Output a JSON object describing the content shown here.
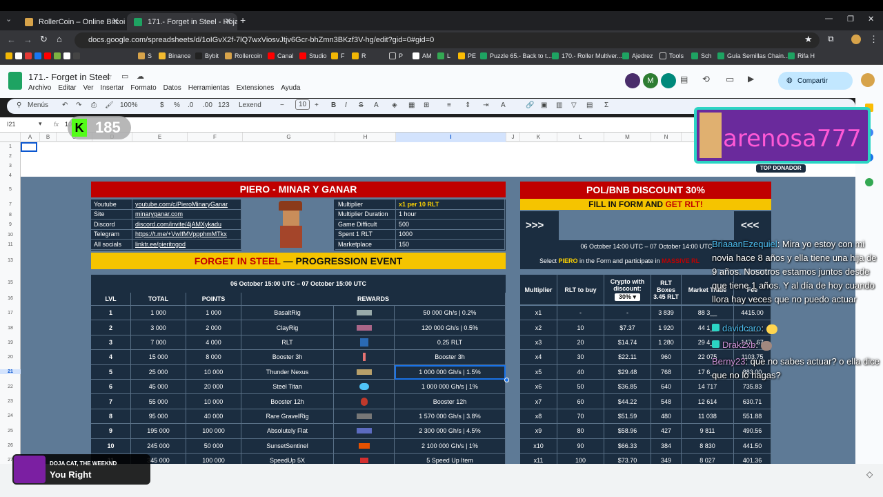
{
  "browser": {
    "tabs": [
      {
        "label": "RollerCoin – Online Bitcoin Mi"
      },
      {
        "label": "171.- Forget in Steel - Hojas de"
      }
    ],
    "url": "docs.google.com/spreadsheets/d/1oIGvX2f-7lQ7wxViosvJtjv6Gcr-bhZmn3BKzf3V-hg/edit?gid=0#gid=0",
    "bookmarks": [
      "S",
      "Binance",
      "Bybit",
      "Rollercoin",
      "Canal",
      "Studio",
      "F",
      "R",
      "P",
      "AM",
      "L",
      "PE",
      "Puzzle 65.- Back to t...",
      "170.- Roller Multiver...",
      "Ajedrez",
      "Tools",
      "Sch",
      "Guía Semillas Chain...",
      "Rifa H"
    ]
  },
  "sheets": {
    "doc_title": "171.- Forget in Steel",
    "menus": [
      "Archivo",
      "Editar",
      "Ver",
      "Insertar",
      "Formato",
      "Datos",
      "Herramientas",
      "Extensiones",
      "Ayuda"
    ],
    "share_label": "Compartir",
    "avatar_letter": "M",
    "menus_search": "Menús",
    "zoom": "100%",
    "font": "Lexend",
    "font_size": "10",
    "number_format": "123",
    "name_box": "I21",
    "formula_value": "10",
    "fx": "fx",
    "columns": [
      "A",
      "B",
      "C",
      "D",
      "E",
      "F",
      "G",
      "H",
      "I",
      "J",
      "K",
      "L",
      "M",
      "N"
    ],
    "rows": [
      "1",
      "2",
      "3",
      "4",
      "5",
      "7",
      "8",
      "9",
      "10",
      "11",
      "13",
      "15",
      "16",
      "17",
      "18",
      "19",
      "20",
      "21",
      "22",
      "23",
      "24",
      "25",
      "26",
      "27"
    ]
  },
  "left": {
    "title": "PIERO - MINAR Y GANAR",
    "links": [
      [
        "Youtube",
        "youtube.com/c/PieroMinaryGanar"
      ],
      [
        "Site",
        "minaryganar.com"
      ],
      [
        "Discord",
        "discord.com/invite/4jAMXykadu"
      ],
      [
        "Telegram",
        "https://t.me/+VwIfMVppphmMTkx"
      ],
      [
        "All socials",
        "linktr.ee/pieritogod"
      ]
    ],
    "info": [
      [
        "Multiplier",
        "x1 per 10 RLT"
      ],
      [
        "Multiplier Duration",
        "1 hour"
      ],
      [
        "Game Difficult",
        "500"
      ],
      [
        "Spent 1 RLT",
        "1000"
      ],
      [
        "Marketplace",
        "150"
      ]
    ],
    "event_prefix": "FORGET IN STEEL",
    "event_suffix": " — PROGRESSION EVENT",
    "date": "06 October 15:00 UTC – 07 October 15:00 UTC",
    "headers": [
      "LVL",
      "TOTAL",
      "POINTS",
      "REWARDS"
    ],
    "rows": [
      [
        "1",
        "1 000",
        "1 000",
        "BasaltRig",
        "50 000 Gh/s  |  0.2%"
      ],
      [
        "2",
        "3 000",
        "2 000",
        "ClayRig",
        "120 000 Gh/s  |  0.5%"
      ],
      [
        "3",
        "7 000",
        "4 000",
        "RLT",
        "0.25 RLT"
      ],
      [
        "4",
        "15 000",
        "8 000",
        "Booster 3h",
        "Booster 3h"
      ],
      [
        "5",
        "25 000",
        "10 000",
        "Thunder Nexus",
        "1 000 000 Gh/s  |  1.5%"
      ],
      [
        "6",
        "45 000",
        "20 000",
        "Steel Titan",
        "1 000 000 Gh/s  |  1%"
      ],
      [
        "7",
        "55 000",
        "10 000",
        "Booster 12h",
        "Booster 12h"
      ],
      [
        "8",
        "95 000",
        "40 000",
        "Rare GravelRig",
        "1 570 000 Gh/s  |  3.8%"
      ],
      [
        "9",
        "195 000",
        "100 000",
        "Absolutely Flat",
        "2 300 000 Gh/s  |  4.5%"
      ],
      [
        "10",
        "245 000",
        "50 000",
        "SunsetSentinel",
        "2 100 000 Gh/s  |  1%"
      ],
      [
        "11",
        "345 000",
        "100 000",
        "SpeedUp 5X",
        "5 Speed Up Item"
      ]
    ]
  },
  "right": {
    "title": "POL/BNB DISCOUNT 30%",
    "fill_prefix": "FILL IN FORM AND ",
    "fill_suffix": "GET RLT!",
    "arrows_left": ">>>",
    "arrows_right": "<<<",
    "date": "06 October 14:00 UTC – 07 October 14:00 UTC",
    "select_prefix": "Select ",
    "select_name": "PIERO",
    "select_suffix": " in the Form and participate in ",
    "select_tail": "MASSIVE RL",
    "headers": [
      "Multiplier",
      "RLT to buy",
      "Crypto with discount:",
      "RLT Boxes",
      "Market Trade",
      "Fee"
    ],
    "discount_value": "30%",
    "boxes_value": "3.45 RLT",
    "rows": [
      [
        "x1",
        "-",
        "-",
        "3 839",
        "88 3__",
        "4415.00"
      ],
      [
        "x2",
        "10",
        "$7.37",
        "1 920",
        "44 1__",
        "___"
      ],
      [
        "x3",
        "20",
        "$14.74",
        "1 280",
        "29 4__",
        "147_.67"
      ],
      [
        "x4",
        "30",
        "$22.11",
        "960",
        "22 075",
        "1103.75"
      ],
      [
        "x5",
        "40",
        "$29.48",
        "768",
        "17 6__",
        "883.00"
      ],
      [
        "x6",
        "50",
        "$36.85",
        "640",
        "14 717",
        "735.83"
      ],
      [
        "x7",
        "60",
        "$44.22",
        "548",
        "12 614",
        "630.71"
      ],
      [
        "x8",
        "70",
        "$51.59",
        "480",
        "11 038",
        "551.88"
      ],
      [
        "x9",
        "80",
        "$58.96",
        "427",
        "9 811",
        "490.56"
      ],
      [
        "x10",
        "90",
        "$66.33",
        "384",
        "8 830",
        "441.50"
      ],
      [
        "x11",
        "100",
        "$73.70",
        "349",
        "8 027",
        "401.36"
      ]
    ]
  },
  "overlay": {
    "counter": "185",
    "donor_name": "arenosa777",
    "donor_badge": "TOP DONADOR",
    "chat": [
      {
        "user": "BriaaanEzequiel",
        "text": ": Mira yo estoy con mi novia hace 8 años y ella tiene una hija de 9 años. Nosotros estamos juntos desde que tiene 1 años. Y al día de hoy cuando llora hay veces que no puedo actuar"
      },
      {
        "user": "davidcaro",
        "text": ":"
      },
      {
        "user": "Drak2xb",
        "text": ":"
      },
      {
        "user": "Berny23",
        "text": ": que no sabes actuar? o ella dice que no lo hagas?"
      }
    ],
    "music_artist": "DOJA CAT, THE WEEKND",
    "music_title": "You Right"
  },
  "colors": {
    "accent_red": "#c00000",
    "accent_yellow": "#f5c400",
    "table_dark": "#1b2d40",
    "sheet_bg": "#5e7a96"
  }
}
